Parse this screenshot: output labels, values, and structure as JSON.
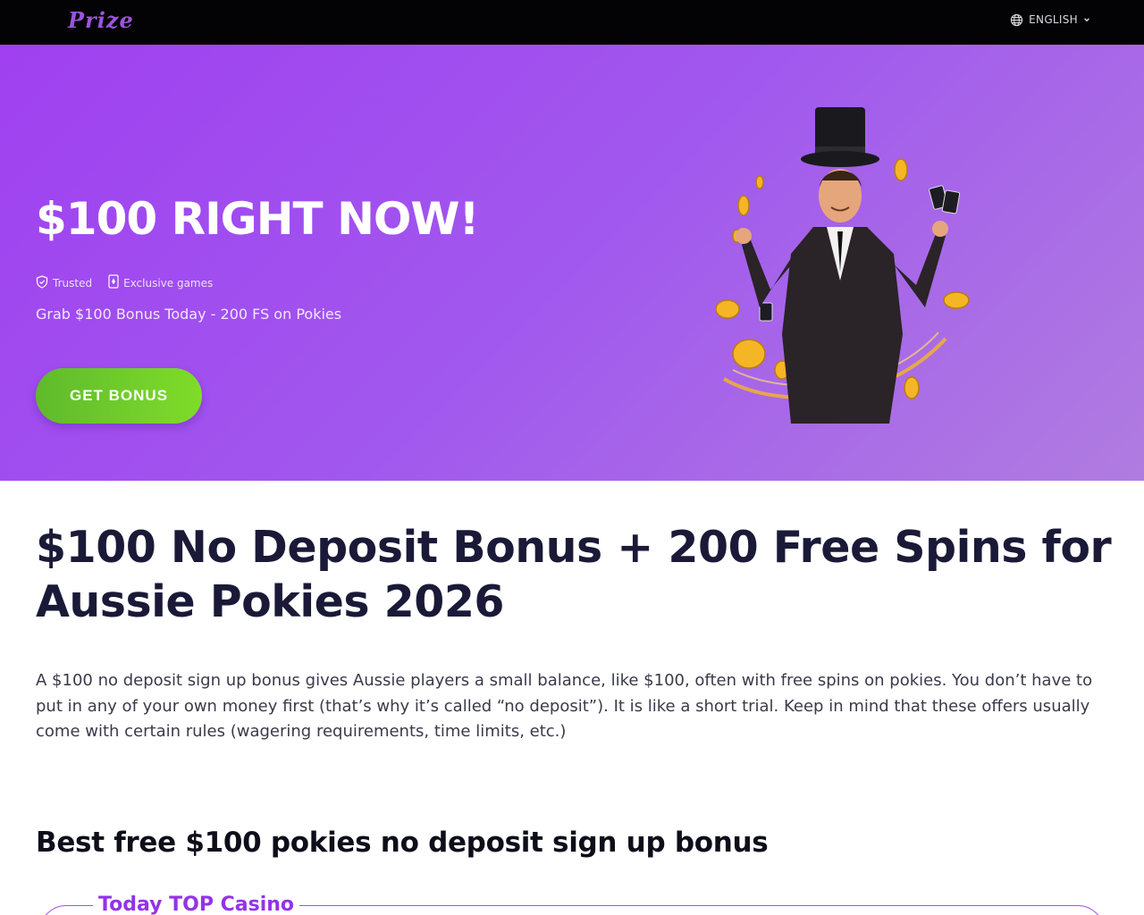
{
  "header": {
    "logo": "Prize",
    "language": "ENGLISH"
  },
  "hero": {
    "title": "$100 RIGHT NOW!",
    "badges": [
      "Trusted",
      "Exclusive games"
    ],
    "subtitle": "Grab $100 Bonus Today - 200 FS on Pokies",
    "cta": "GET BONUS"
  },
  "main": {
    "title": "$100 No Deposit Bonus + 200 Free Spins for Aussie Pokies 2026",
    "intro": "A $100 no deposit sign up bonus gives Aussie players a small balance, like $100, often with free spins on pokies. You don’t have to put in any of your own money first (that’s why it’s called “no deposit”). It is like a short trial. Keep in mind that these offers usually come with certain rules (wagering requirements, time limits, etc.)",
    "section_title": "Best free $100 pokies no deposit sign up bonus",
    "top_casino_label": "Today TOP Casino"
  },
  "colors": {
    "accent": "#9433e6",
    "cta": "#6cc42a",
    "hero_bg": "#a158ee",
    "topbar": "#030205"
  },
  "icons": {
    "language": "globe-icon",
    "dropdown": "chevron-down-icon",
    "trusted": "shield-check-icon",
    "exclusive": "card-icon"
  }
}
